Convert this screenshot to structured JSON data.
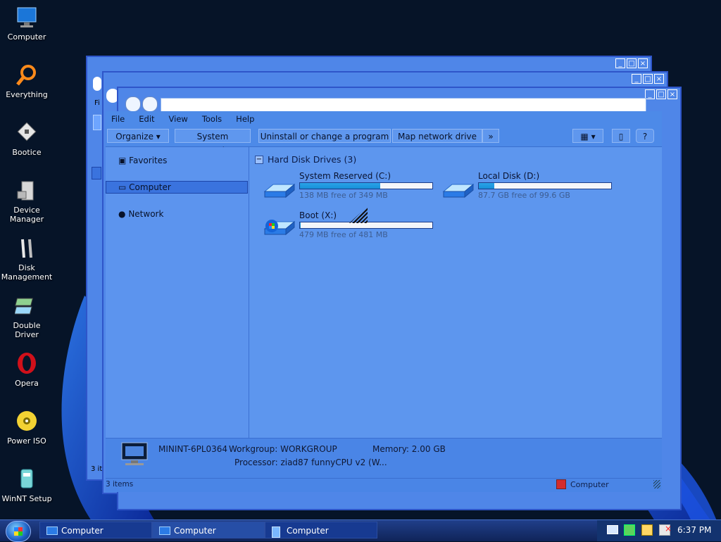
{
  "desktop": {
    "icons": [
      {
        "label": "Computer",
        "icon": "computer-icon"
      },
      {
        "label": "Everything",
        "icon": "magnifier-icon"
      },
      {
        "label": "Bootice",
        "icon": "bootice-icon"
      },
      {
        "label": "Device\nManager",
        "icon": "device-manager-icon"
      },
      {
        "label": "Disk\nManagement",
        "icon": "disk-management-icon"
      },
      {
        "label": "Double Driver",
        "icon": "double-driver-icon"
      },
      {
        "label": "Opera",
        "icon": "opera-icon"
      },
      {
        "label": "Power ISO",
        "icon": "power-iso-icon"
      },
      {
        "label": "WinNT Setup",
        "icon": "winnt-setup-icon"
      }
    ]
  },
  "window": {
    "menu": [
      "File",
      "Edit",
      "View",
      "Tools",
      "Help"
    ],
    "toolbar": {
      "organize": "Organize",
      "system_properties": "System properties",
      "uninstall": "Uninstall or change a program",
      "map_drive": "Map network drive",
      "more": "»"
    },
    "nav": {
      "favorites": "Favorites",
      "computer": "Computer",
      "network": "Network"
    },
    "group_header": "Hard Disk Drives (3)",
    "drives": [
      {
        "name": "System Reserved (C:)",
        "free_text": "138 MB free of 349 MB",
        "used_fraction": 0.604
      },
      {
        "name": "Local Disk (D:)",
        "free_text": "87.7 GB free of 99.6 GB",
        "used_fraction": 0.119
      },
      {
        "name": "Boot (X:)",
        "free_text": "479 MB free of 481 MB",
        "used_fraction": 0.004
      }
    ],
    "details": {
      "computer_name": "MININT-6PL0364",
      "workgroup": "Workgroup: WORKGROUP",
      "memory": "Memory: 2.00 GB",
      "processor": "Processor: ziad87 funnyCPU v2 (W..."
    },
    "status": {
      "items": "3 items",
      "behind_items": "3 it",
      "location": "Computer"
    },
    "behind_menu_partial": "Fi"
  },
  "taskbar": {
    "buttons": [
      "Computer",
      "Computer",
      "Computer"
    ],
    "clock": "6:37 PM"
  },
  "colors": {
    "accent": "#4f86e8",
    "taskbar": "#173a91",
    "desktop_bg": "#061428"
  }
}
